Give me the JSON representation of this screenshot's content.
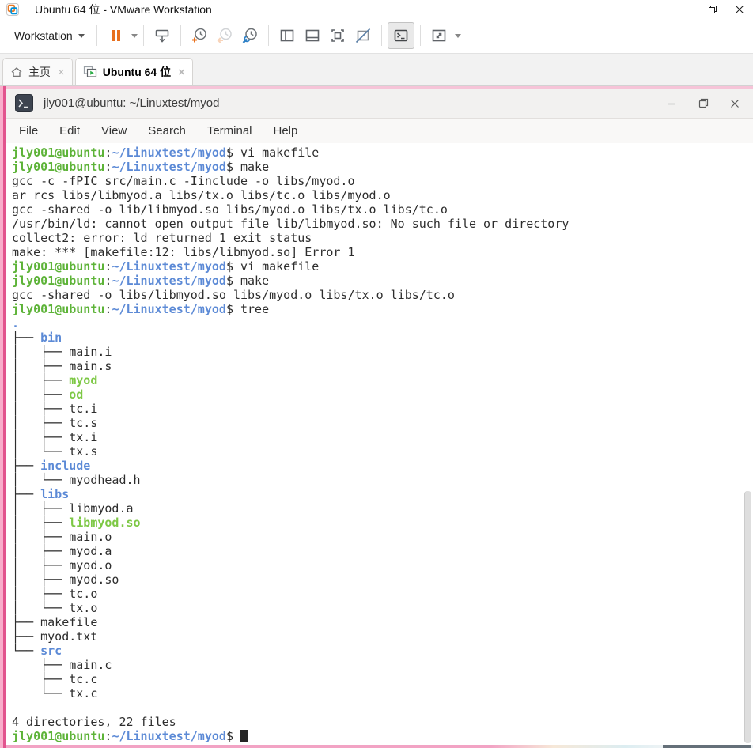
{
  "colors": {
    "accent_orange": "#e8701e",
    "snapshot_blue": "#2e80c6",
    "prompt_green": "#5db338",
    "path_blue": "#5c8ad6",
    "exec_green": "#7dc845",
    "wallpaper_pink": "#f9aecb",
    "wallpaper_magenta": "#e2548e",
    "terminal_bg": "#ffffff"
  },
  "window": {
    "title": "Ubuntu 64 位 - VMware Workstation",
    "minimize_icon": "minimize",
    "restore_icon": "restore",
    "close_icon": "close"
  },
  "toolbar": {
    "workstation_label": "Workstation",
    "icons": [
      "pause",
      "send-ctrl-alt-del",
      "snapshot-take",
      "snapshot-revert",
      "snapshot-manage",
      "show-library-panel",
      "show-thumbnail-bar",
      "fit-guest-now",
      "free-stretch-disabled",
      "console-view",
      "fullscreen"
    ]
  },
  "tabs": [
    {
      "label": "主页",
      "icon": "home-icon",
      "active": false,
      "close_glyph": "×"
    },
    {
      "label": "Ubuntu 64 位",
      "icon": "vm-screen-icon",
      "active": true,
      "close_glyph": "×"
    }
  ],
  "terminal": {
    "title": "jly001@ubuntu: ~/Linuxtest/myod",
    "app_icon": "terminal-icon",
    "menu": [
      "File",
      "Edit",
      "View",
      "Search",
      "Terminal",
      "Help"
    ],
    "status_line": "4 directories, 22 files",
    "lines": [
      [
        [
          "g",
          "jly001@ubuntu"
        ],
        [
          "k",
          ":"
        ],
        [
          "b",
          "~/Linuxtest/myod"
        ],
        [
          "k",
          "$ vi makefile"
        ]
      ],
      [
        [
          "g",
          "jly001@ubuntu"
        ],
        [
          "k",
          ":"
        ],
        [
          "b",
          "~/Linuxtest/myod"
        ],
        [
          "k",
          "$ make"
        ]
      ],
      [
        [
          "k",
          "gcc -c -fPIC src/main.c -Iinclude -o libs/myod.o"
        ]
      ],
      [
        [
          "k",
          "ar rcs libs/libmyod.a libs/tx.o libs/tc.o libs/myod.o"
        ]
      ],
      [
        [
          "k",
          "gcc -shared -o lib/libmyod.so libs/myod.o libs/tx.o libs/tc.o"
        ]
      ],
      [
        [
          "k",
          "/usr/bin/ld: cannot open output file lib/libmyod.so: No such file or directory"
        ]
      ],
      [
        [
          "k",
          "collect2: error: ld returned 1 exit status"
        ]
      ],
      [
        [
          "k",
          "make: *** [makefile:12: libs/libmyod.so] Error 1"
        ]
      ],
      [
        [
          "g",
          "jly001@ubuntu"
        ],
        [
          "k",
          ":"
        ],
        [
          "b",
          "~/Linuxtest/myod"
        ],
        [
          "k",
          "$ vi makefile"
        ]
      ],
      [
        [
          "g",
          "jly001@ubuntu"
        ],
        [
          "k",
          ":"
        ],
        [
          "b",
          "~/Linuxtest/myod"
        ],
        [
          "k",
          "$ make"
        ]
      ],
      [
        [
          "k",
          "gcc -shared -o libs/libmyod.so libs/myod.o libs/tx.o libs/tc.o"
        ]
      ],
      [
        [
          "g",
          "jly001@ubuntu"
        ],
        [
          "k",
          ":"
        ],
        [
          "b",
          "~/Linuxtest/myod"
        ],
        [
          "k",
          "$ tree"
        ]
      ],
      [
        [
          "b",
          "."
        ]
      ],
      [
        [
          "k",
          "├── "
        ],
        [
          "b",
          "bin"
        ]
      ],
      [
        [
          "k",
          "│   ├── main.i"
        ]
      ],
      [
        [
          "k",
          "│   ├── main.s"
        ]
      ],
      [
        [
          "k",
          "│   ├── "
        ],
        [
          "e",
          "myod"
        ]
      ],
      [
        [
          "k",
          "│   ├── "
        ],
        [
          "e",
          "od"
        ]
      ],
      [
        [
          "k",
          "│   ├── tc.i"
        ]
      ],
      [
        [
          "k",
          "│   ├── tc.s"
        ]
      ],
      [
        [
          "k",
          "│   ├── tx.i"
        ]
      ],
      [
        [
          "k",
          "│   └── tx.s"
        ]
      ],
      [
        [
          "k",
          "├── "
        ],
        [
          "b",
          "include"
        ]
      ],
      [
        [
          "k",
          "│   └── myodhead.h"
        ]
      ],
      [
        [
          "k",
          "├── "
        ],
        [
          "b",
          "libs"
        ]
      ],
      [
        [
          "k",
          "│   ├── libmyod.a"
        ]
      ],
      [
        [
          "k",
          "│   ├── "
        ],
        [
          "e",
          "libmyod.so"
        ]
      ],
      [
        [
          "k",
          "│   ├── main.o"
        ]
      ],
      [
        [
          "k",
          "│   ├── myod.a"
        ]
      ],
      [
        [
          "k",
          "│   ├── myod.o"
        ]
      ],
      [
        [
          "k",
          "│   ├── myod.so"
        ]
      ],
      [
        [
          "k",
          "│   ├── tc.o"
        ]
      ],
      [
        [
          "k",
          "│   └── tx.o"
        ]
      ],
      [
        [
          "k",
          "├── makefile"
        ]
      ],
      [
        [
          "k",
          "├── myod.txt"
        ]
      ],
      [
        [
          "k",
          "└── "
        ],
        [
          "b",
          "src"
        ]
      ],
      [
        [
          "k",
          "    ├── main.c"
        ]
      ],
      [
        [
          "k",
          "    ├── tc.c"
        ]
      ],
      [
        [
          "k",
          "    └── tx.c"
        ]
      ],
      [],
      [
        [
          "k",
          "4 directories, 22 files"
        ]
      ],
      [
        [
          "g",
          "jly001@ubuntu"
        ],
        [
          "k",
          ":"
        ],
        [
          "b",
          "~/Linuxtest/myod"
        ],
        [
          "k",
          "$ "
        ],
        [
          "cursor",
          ""
        ]
      ]
    ]
  }
}
